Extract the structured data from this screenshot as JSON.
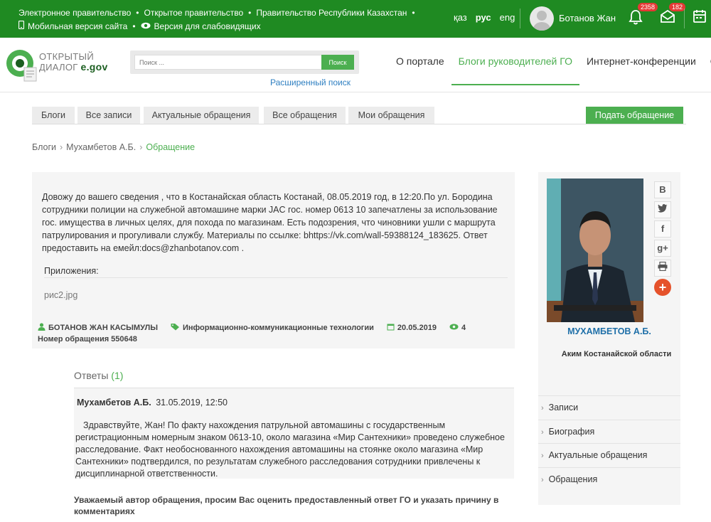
{
  "topbar": {
    "links_row1": [
      "Электронное правительство",
      "Открытое правительство",
      "Правительство Республики Казахстан"
    ],
    "mobile_link": "Мобильная версия сайта",
    "accessibility_link": "Версия для слабовидящих",
    "langs": [
      "қаз",
      "рус",
      "eng"
    ],
    "active_lang": "рус",
    "username": "Ботанов Жан",
    "notifications_count": "2358",
    "messages_count": "182",
    "icons": [
      "phone-icon",
      "eye-icon",
      "bell-icon",
      "envelope-icon",
      "calendar-icon"
    ]
  },
  "header": {
    "logo_line1": "ОТКРЫТЫЙ",
    "logo_line2": "ДИАЛОГ",
    "logo_brand": "e.gov",
    "search_placeholder": "Поиск ...",
    "search_button": "Поиск",
    "advanced_search": "Расширенный поиск",
    "nav": [
      "О портале",
      "Блоги руководителей ГО",
      "Интернет-конференции",
      "Опро"
    ],
    "active_nav": "Блоги руководителей ГО"
  },
  "tabs": [
    "Блоги",
    "Все записи",
    "Актуальные обращения",
    "Все обращения",
    "Мои обращения"
  ],
  "submit_button": "Подать обращение",
  "breadcrumb": [
    "Блоги",
    "Мухамбетов А.Б.",
    "Обращение"
  ],
  "appeal": {
    "text": "Довожу до вашего сведения , что в Костанайская область Костанай, 08.05.2019 год, в 12:20.По ул. Бородина сотрудники полиции на служебной автомашине марки JAC гос. номер 0613 10 запечатлены за использование гос. имущества в личных целях, для похода по магазинам. Есть подозрения, что чиновники ушли с маршрута патрулирования и прогуливали службу. Материалы по ссылке: bhttps://vk.com/wall-59388124_183625. Ответ предоставить на емейл:docs@zhanbotanov.com .",
    "attachments_label": "Приложения:",
    "attachment_file": "рис2.jpg",
    "author": "БОТАНОВ ЖАН КАСЫМУЛЫ",
    "category": "Информационно-коммуникационные технологии",
    "date": "20.05.2019",
    "views": "4",
    "request_number": "Номер обращения 550648"
  },
  "answers": {
    "title": "Ответы",
    "count": "(1)",
    "items": [
      {
        "author": "Мухамбетов А.Б.",
        "datetime": "31.05.2019, 12:50",
        "text": "Здравствуйте, Жан! По факту нахождения патрульной автомашины с государственным регистрационным номерным знаком 0613-10, около магазина «Мир Сантехники» проведено служебное расследование. Факт необоснованного нахождения автомашины на стоянке около магазина «Мир Сантехники» подтвердился, по результатам служебного расследования сотрудники привлечены к дисциплинарной ответственности."
      }
    ],
    "rate_prompt": "Уважаемый автор обращения, просим Вас оценить предоставленный ответ ГО и указать причину в комментариях"
  },
  "sidebar": {
    "official_name": "МУХАМБЕТОВ А.Б.",
    "official_title": "Аким Костанайской области",
    "share_buttons": [
      "В",
      "twitter-icon",
      "f",
      "g+",
      "print-icon",
      "plus-icon"
    ],
    "menu": [
      "Записи",
      "Биография",
      "Актуальные обращения",
      "Обращения"
    ]
  },
  "colors": {
    "brand_green": "#1f8a22",
    "accent_green": "#4caf50",
    "link_blue": "#2e7fc1",
    "badge_red": "#e53935"
  }
}
